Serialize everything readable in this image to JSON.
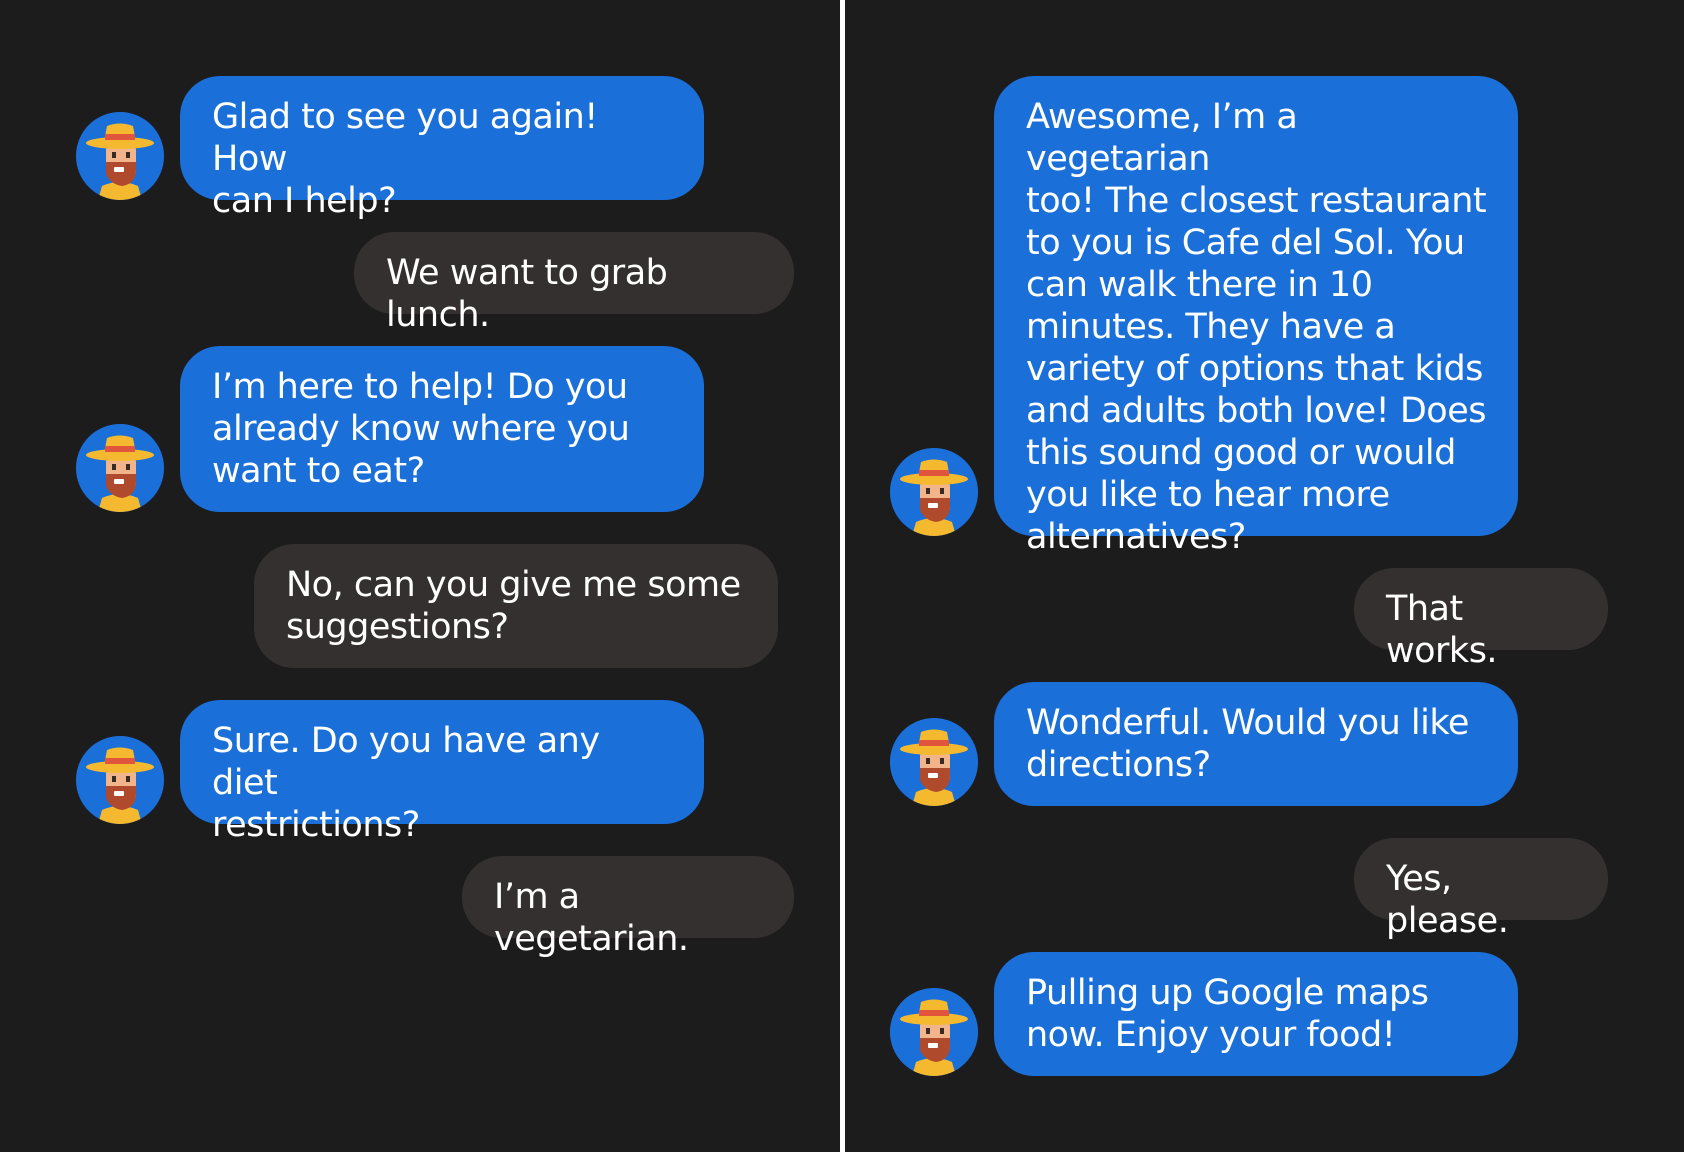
{
  "conversation": {
    "left": [
      {
        "role": "bot",
        "text": "Glad to see you again! How\ncan I help?"
      },
      {
        "role": "user",
        "text": "We want to grab lunch."
      },
      {
        "role": "bot",
        "text": "I’m here to help! Do you\nalready know where you\nwant to eat?"
      },
      {
        "role": "user",
        "text": "No, can you give me some\nsuggestions?"
      },
      {
        "role": "bot",
        "text": "Sure. Do you have any diet\nrestrictions?"
      },
      {
        "role": "user",
        "text": "I’m a vegetarian."
      }
    ],
    "right": [
      {
        "role": "bot",
        "text": "Awesome, I’m a vegetarian\ntoo! The closest restaurant\nto you is Cafe del Sol. You\ncan walk there in 10\nminutes. They have a\nvariety of options that kids\nand adults both love! Does\nthis sound good or would\nyou like to hear more\nalternatives?"
      },
      {
        "role": "user",
        "text": "That works."
      },
      {
        "role": "bot",
        "text": "Wonderful. Would you like\ndirections?"
      },
      {
        "role": "user",
        "text": "Yes, please."
      },
      {
        "role": "bot",
        "text": "Pulling up Google maps\nnow. Enjoy your food!"
      }
    ]
  },
  "avatar": {
    "icon": "bearded-man-straw-hat-icon"
  },
  "colors": {
    "background": "#1c1c1d",
    "bot_bubble": "#1a6fd9",
    "user_bubble": "#343030",
    "text": "#ffffff",
    "divider": "#ffffff"
  }
}
